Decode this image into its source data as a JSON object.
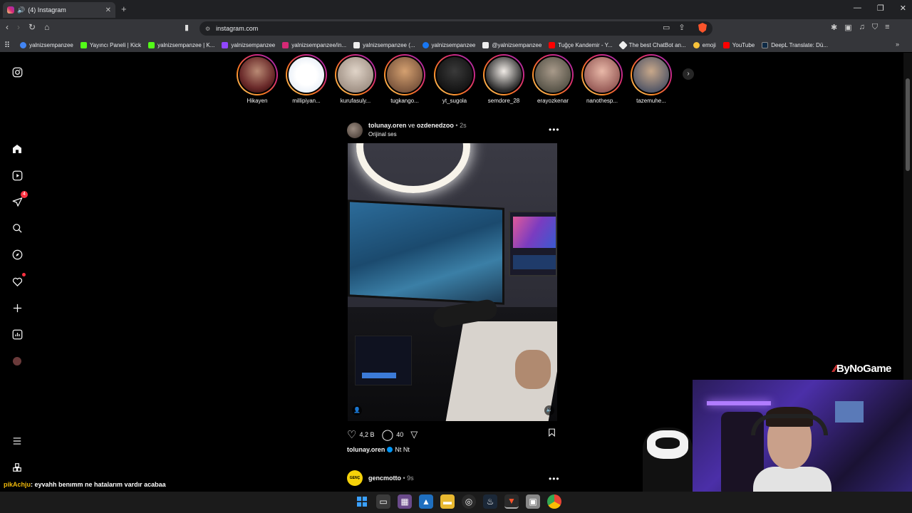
{
  "browser": {
    "tab_title": "(4) Instagram",
    "new_tab": "+",
    "url": "instagram.com",
    "bookmarks": [
      {
        "label": "yalnizsempanzee",
        "icon": "google-icon",
        "color": "#4285f4"
      },
      {
        "label": "Yayıncı Paneli | Kick",
        "icon": "kick-icon",
        "color": "#53fc18"
      },
      {
        "label": "yalnizsempanzee | K...",
        "icon": "kick-icon",
        "color": "#53fc18"
      },
      {
        "label": "yalnizsempanzee",
        "icon": "twitch-icon",
        "color": "#9146ff"
      },
      {
        "label": "yalnizsempanzee/in...",
        "icon": "instagram-icon",
        "color": "#d62976"
      },
      {
        "label": "yalnizsempanzee (...",
        "icon": "tiktok-icon",
        "color": "#ffffff"
      },
      {
        "label": "yalnizsempanzee",
        "icon": "facebook-icon",
        "color": "#1877f2"
      },
      {
        "label": "@yalnizsempanzee",
        "icon": "x-icon",
        "color": "#ffffff"
      },
      {
        "label": "Tuğçe Kandemir - Y...",
        "icon": "youtube-icon",
        "color": "#ff0000"
      },
      {
        "label": "The best ChatBot an...",
        "icon": "chatbot-icon",
        "color": "#ffffff"
      },
      {
        "label": "emoji",
        "icon": "emoji-icon",
        "color": "#f7c23a"
      },
      {
        "label": "YouTube",
        "icon": "youtube-icon",
        "color": "#ff0000"
      },
      {
        "label": "DeepL Translate: Dü...",
        "icon": "deepl-icon",
        "color": "#0f2b46"
      }
    ]
  },
  "sidebar": {
    "notifications_badge": "4"
  },
  "stories": [
    {
      "label": "Hikayen",
      "color": "#6a3a3a"
    },
    {
      "label": "millipiyan...",
      "color": "#e9eef5"
    },
    {
      "label": "kurufasuly...",
      "color": "#b7a99e"
    },
    {
      "label": "tugkango...",
      "color": "#a07050"
    },
    {
      "label": "yt_sugola",
      "color": "#151515"
    },
    {
      "label": "semdore_28",
      "color": "#e8e2dc"
    },
    {
      "label": "erayozkenar",
      "color": "#6b6b5e"
    },
    {
      "label": "nanothesp...",
      "color": "#c98a80"
    },
    {
      "label": "tazemuhe...",
      "color": "#3a4a6a"
    }
  ],
  "post": {
    "user": "tolunay.oren",
    "joiner": "ve",
    "collab": "ozdenedzoo",
    "time": "2s",
    "audio": "Orijinal ses",
    "likes": "4,2 B",
    "comments": "40",
    "caption_user": "tolunay.oren",
    "caption_text": "Nt Nt"
  },
  "post2": {
    "user": "gencmotto",
    "time": "9s",
    "avatar_text": "GENÇ MOTTO"
  },
  "overlay": {
    "brand": "ByNoGame",
    "chat_user": "pikAchju",
    "chat_message": ": eyvahh benımm ne hatalarım vardır acabaa"
  }
}
